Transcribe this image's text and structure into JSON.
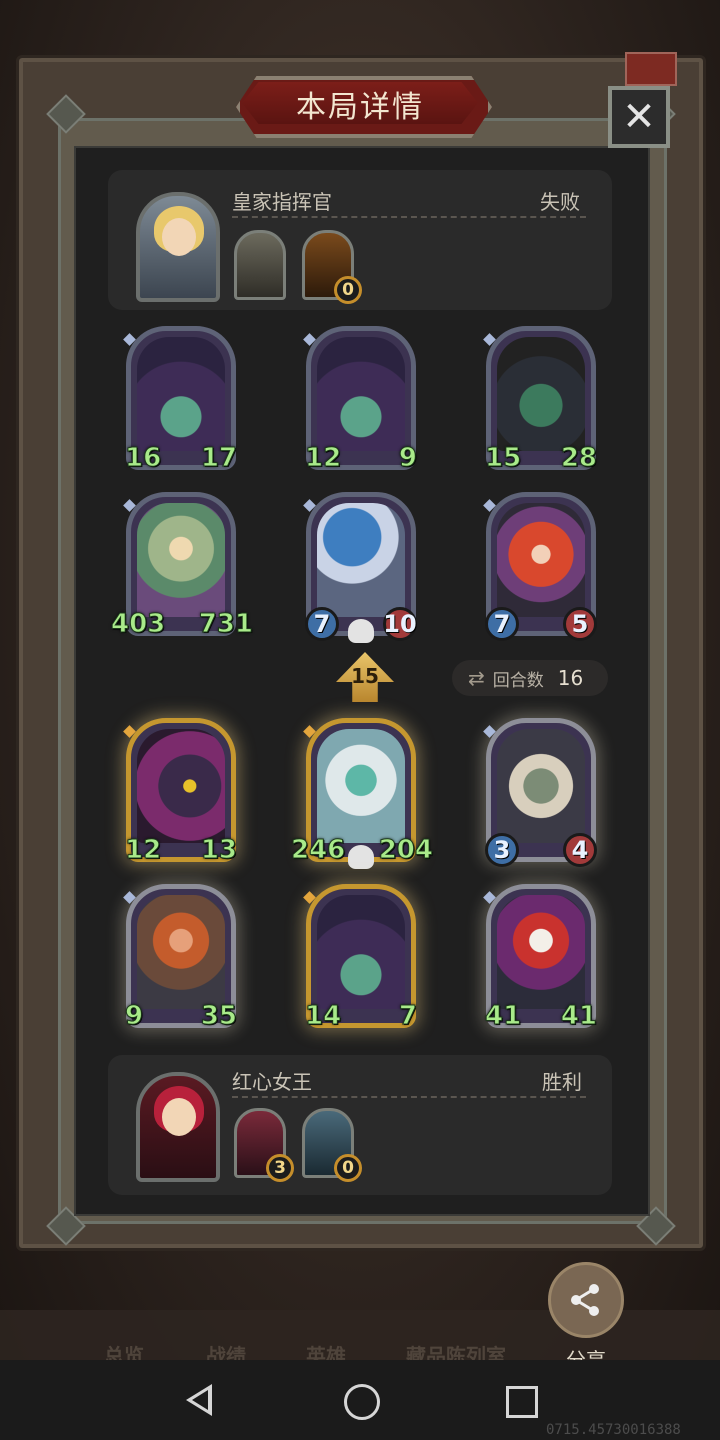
{
  "title": "本局详情",
  "close_symbol": "✕",
  "top_player": {
    "name": "皇家指挥官",
    "result": "失败",
    "item_count": "0"
  },
  "bottom_player": {
    "name": "红心女王",
    "result": "胜利",
    "item_counts": [
      "3",
      "0"
    ]
  },
  "top_units": [
    {
      "art": "witch",
      "attack": "16",
      "health": "17"
    },
    {
      "art": "witch",
      "attack": "12",
      "health": "9"
    },
    {
      "art": "tree",
      "attack": "15",
      "health": "28"
    },
    {
      "art": "dryad",
      "attack": "403",
      "health": "731"
    },
    {
      "art": "shroom",
      "attack": "7",
      "health": "10",
      "dead": true
    },
    {
      "art": "redhair",
      "attack": "7",
      "health": "5"
    }
  ],
  "bottom_units": [
    {
      "art": "dragon",
      "attack": "12",
      "health": "13",
      "frame": "gold"
    },
    {
      "art": "yeti",
      "attack": "246",
      "health": "204",
      "frame": "gold",
      "dead": true
    },
    {
      "art": "beast",
      "attack": "3",
      "health": "4",
      "frame": "silver"
    },
    {
      "art": "barb",
      "attack": "9",
      "health": "35",
      "frame": "silver"
    },
    {
      "art": "witch",
      "attack": "14",
      "health": "7",
      "frame": "gold"
    },
    {
      "art": "clown",
      "attack": "41",
      "health": "41",
      "frame": "silver"
    }
  ],
  "rank_change": "15",
  "rounds": {
    "label": "回合数",
    "value": "16"
  },
  "share_label": "分享",
  "background_tabs": [
    "总览",
    "战绩",
    "英雄",
    "藏品陈列室"
  ],
  "build_id": "0715.45730016388"
}
